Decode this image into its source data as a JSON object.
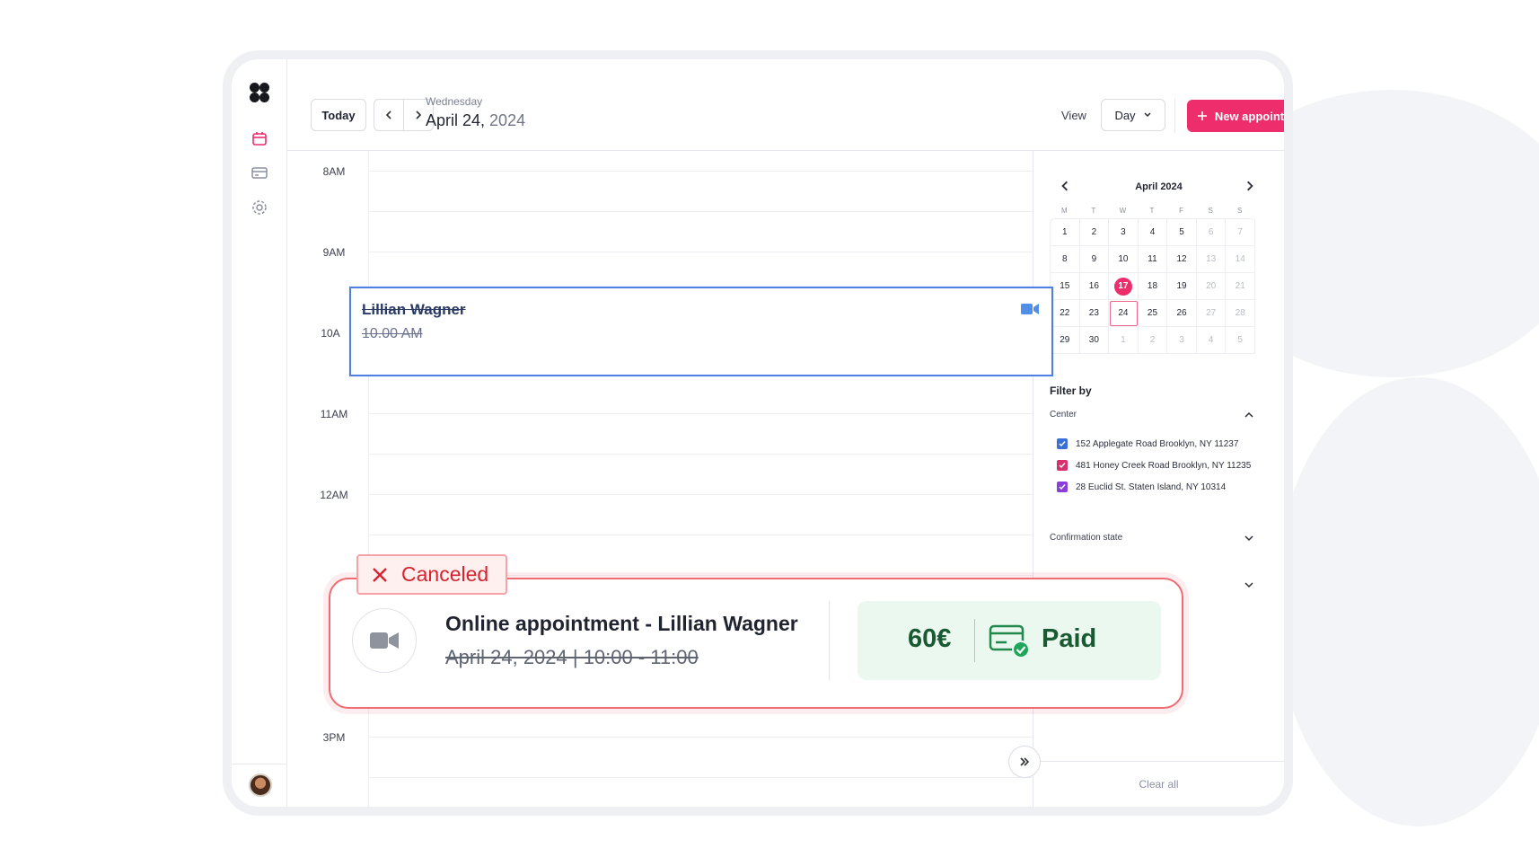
{
  "toolbar": {
    "today_label": "Today",
    "weekday": "Wednesday",
    "date_main": "April 24,",
    "date_year": " 2024",
    "view_label": "View",
    "view_value": "Day",
    "new_appointment_label": "New appointment"
  },
  "grid": {
    "hours": [
      "8AM",
      "9AM",
      "10A",
      "11AM",
      "12AM",
      "3PM"
    ]
  },
  "appointment": {
    "name": "Lillian Wagner",
    "time": "10.00 AM",
    "status_color": "#4f7fe0"
  },
  "calendar": {
    "title": "April 2024",
    "weekdays": [
      "M",
      "T",
      "W",
      "T",
      "F",
      "S",
      "S"
    ],
    "weeks": [
      [
        "1",
        "2",
        "3",
        "4",
        "5",
        "6",
        "7"
      ],
      [
        "8",
        "9",
        "10",
        "11",
        "12",
        "13",
        "14"
      ],
      [
        "15",
        "16",
        "17",
        "18",
        "19",
        "20",
        "21"
      ],
      [
        "22",
        "23",
        "24",
        "25",
        "26",
        "27",
        "28"
      ],
      [
        "29",
        "30",
        "1",
        "2",
        "3",
        "4",
        "5"
      ]
    ],
    "today": "17",
    "selected": "24"
  },
  "filters": {
    "title": "Filter by",
    "center_label": "Center",
    "centers": [
      {
        "label": "152 Applegate Road Brooklyn, NY 11237",
        "color": "#3a6fd8"
      },
      {
        "label": "481 Honey Creek Road Brooklyn, NY 11235",
        "color": "#d8306e"
      },
      {
        "label": "28 Euclid St. Staten Island, NY 10314",
        "color": "#8a3fd8"
      }
    ],
    "confirmation_label": "Confirmation state",
    "clear_all": "Clear all"
  },
  "card": {
    "status": "Canceled",
    "title": "Online appointment - Lillian Wagner",
    "subtitle": "April 24, 2024 | 10:00 - 11:00",
    "amount": "60€",
    "payment_status": "Paid"
  },
  "colors": {
    "accent": "#ee2d6c",
    "canceled": "#d6232f",
    "paid_text": "#1a5a33",
    "paid_bg": "#ebf8ef"
  }
}
